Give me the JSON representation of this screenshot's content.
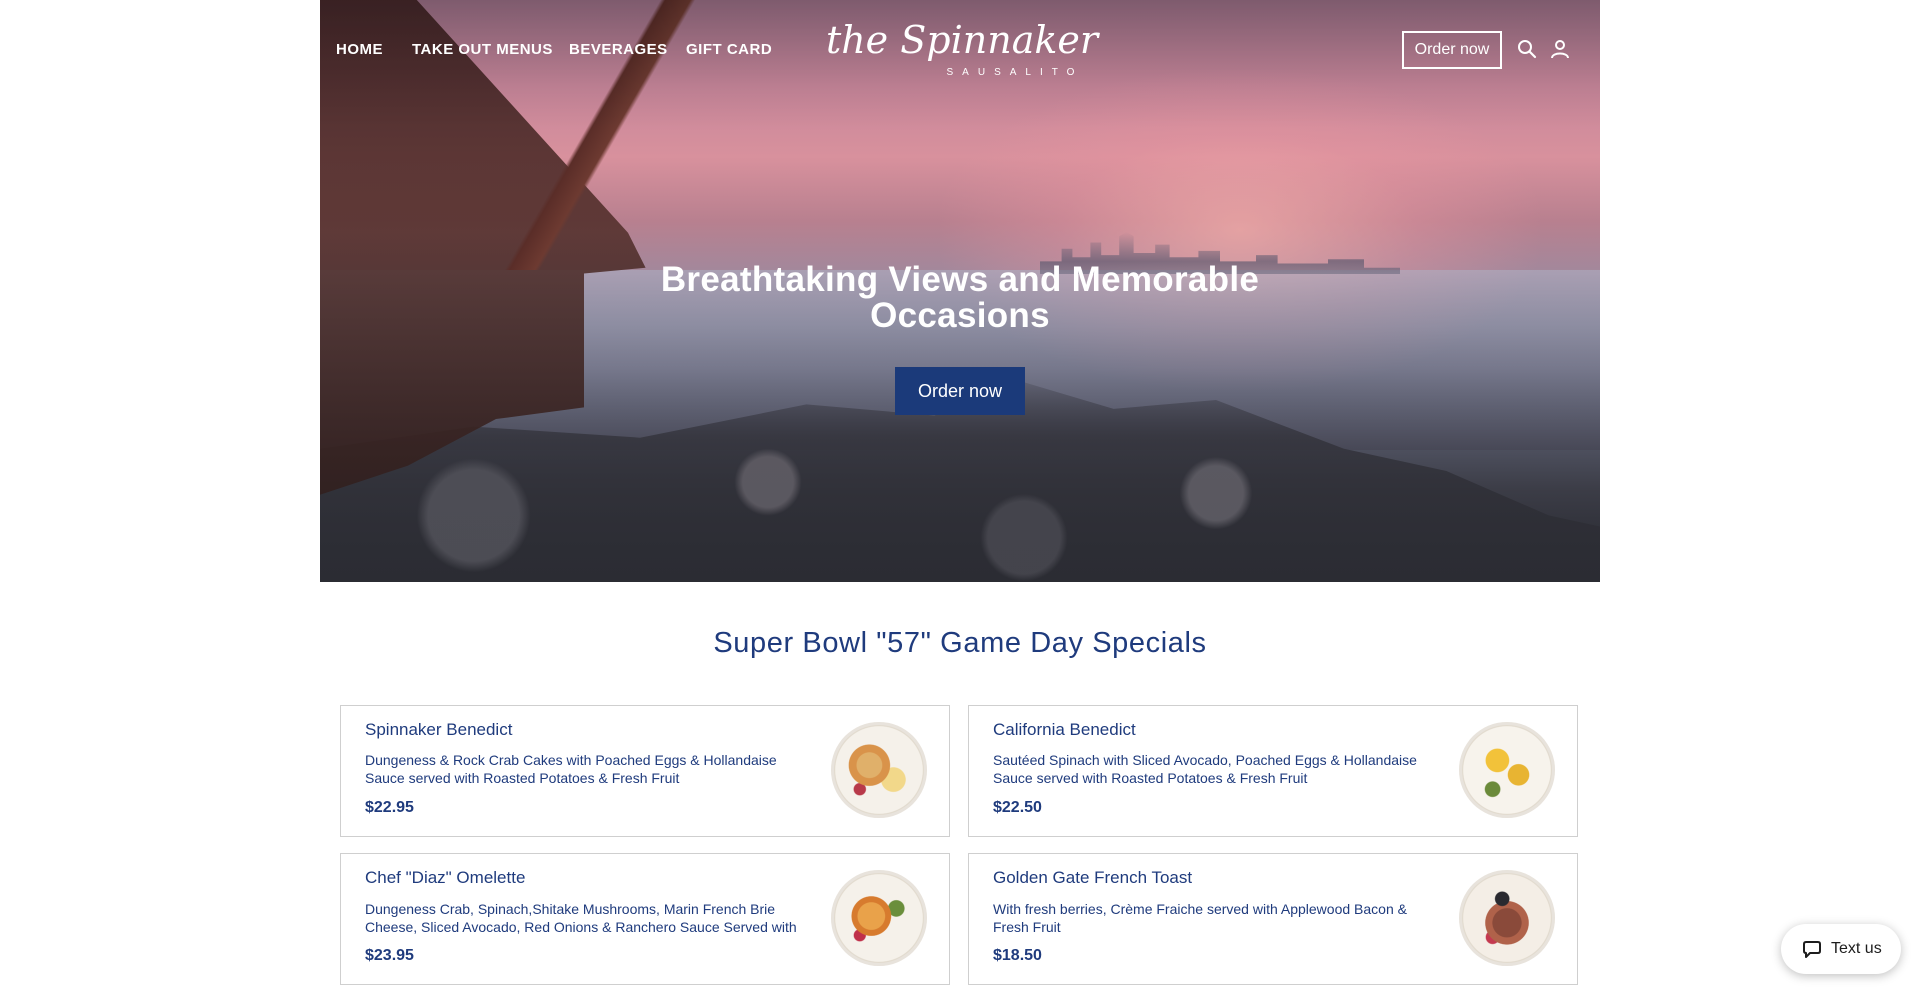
{
  "nav": {
    "links": [
      "HOME",
      "TAKE OUT MENUS",
      "BEVERAGES",
      "GIFT CARD"
    ],
    "order_label": "Order now",
    "icons": [
      "search-icon",
      "user-icon"
    ]
  },
  "logo": {
    "script": "the Spinnaker",
    "sub": "SAUSALITO"
  },
  "hero": {
    "title_line1": "Breathtaking Views and Memorable",
    "title_line2": "Occasions",
    "order_label": "Order now",
    "button_color": "#1b3a7a"
  },
  "section": {
    "title": "Super Bowl \"57\" Game Day Specials"
  },
  "menu": [
    {
      "name": "Spinnaker Benedict",
      "description": "Dungeness & Rock Crab Cakes with Poached Eggs & Hollandaise Sauce served with Roasted Potatoes & Fresh Fruit",
      "price": "$22.95"
    },
    {
      "name": "California Benedict",
      "description": "Sautéed Spinach with Sliced Avocado, Poached Eggs & Hollandaise Sauce served with Roasted Potatoes & Fresh Fruit",
      "price": "$22.50"
    },
    {
      "name": "Chef \"Diaz\" Omelette",
      "description": "Dungeness Crab, Spinach,Shitake Mushrooms, Marin French Brie Cheese, Sliced Avocado, Red Onions & Ranchero Sauce Served with",
      "price": "$23.95"
    },
    {
      "name": "Golden Gate French Toast",
      "description": "With fresh berries, Crème Fraiche served with Applewood Bacon & Fresh Fruit",
      "price": "$18.50"
    }
  ],
  "text_us": {
    "label": "Text us"
  },
  "colors": {
    "text_primary": "#1f3b7d",
    "card_border": "#cfcfcf"
  }
}
